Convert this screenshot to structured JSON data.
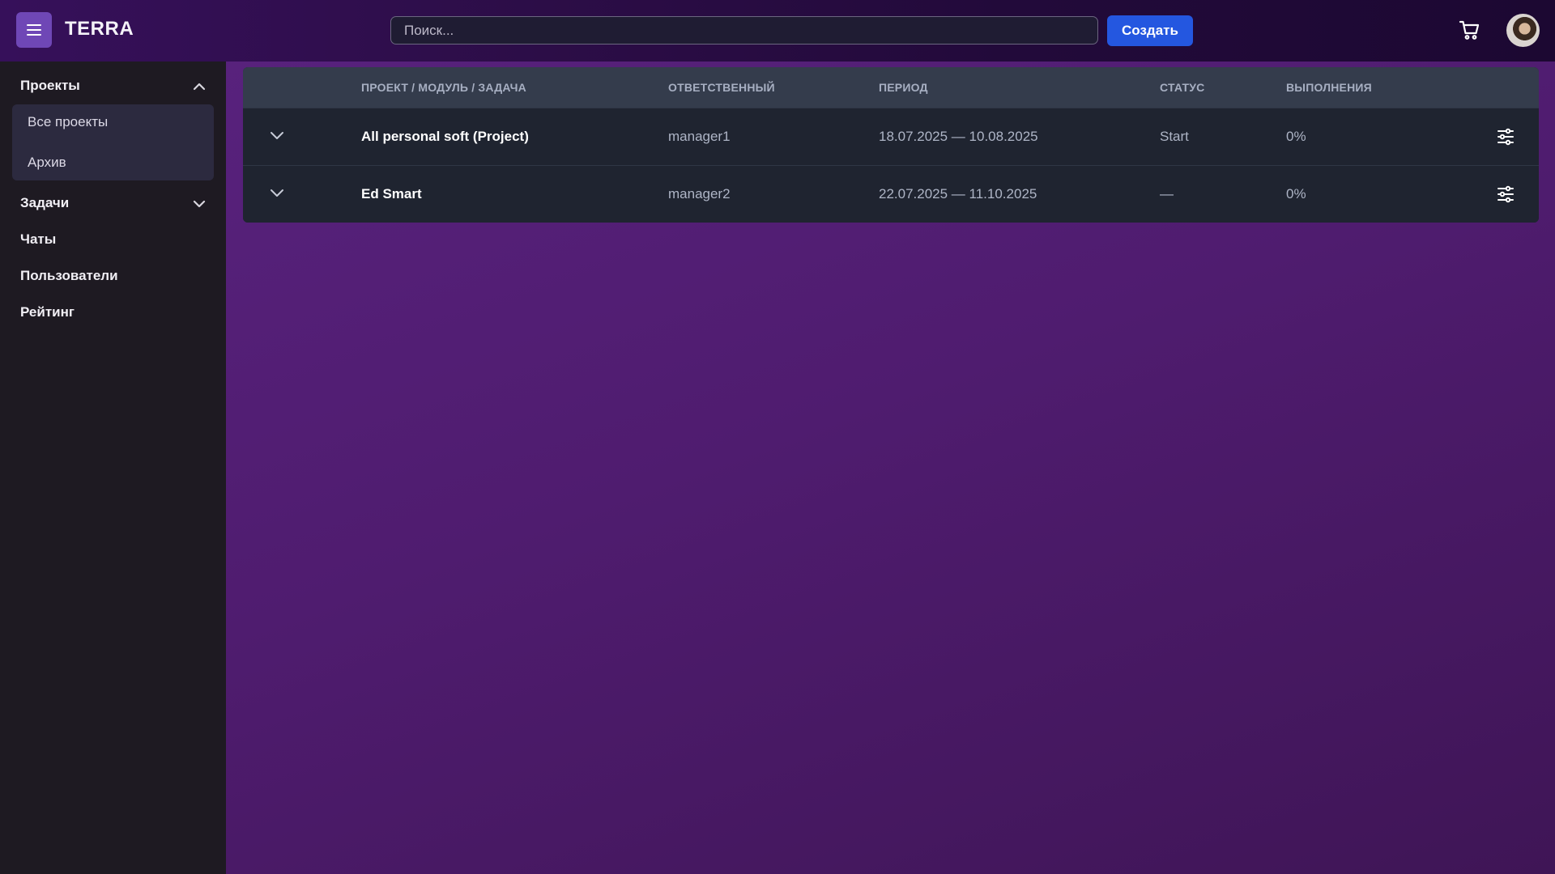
{
  "header": {
    "logo": "TERRA",
    "search_placeholder": "Поиск...",
    "create_label": "Создать"
  },
  "sidebar": {
    "sections": [
      {
        "label": "Проекты",
        "expanded": true,
        "items": [
          {
            "label": "Все проекты"
          },
          {
            "label": "Архив"
          }
        ]
      },
      {
        "label": "Задачи",
        "expanded": false
      },
      {
        "label": "Чаты"
      },
      {
        "label": "Пользователи"
      },
      {
        "label": "Рейтинг"
      }
    ]
  },
  "table": {
    "headers": {
      "project": "ПРОЕКТ / МОДУЛЬ / ЗАДАЧА",
      "responsible": "ОТВЕТСТВЕННЫЙ",
      "period": "ПЕРИОД",
      "status": "СТАТУС",
      "completion": "ВЫПОЛНЕНИЯ"
    },
    "rows": [
      {
        "name": "All personal soft (Project)",
        "responsible": "manager1",
        "period": "18.07.2025 — 10.08.2025",
        "status": "Start",
        "completion": "0%"
      },
      {
        "name": "Ed Smart",
        "responsible": "manager2",
        "period": "22.07.2025 — 11.10.2025",
        "status": "—",
        "completion": "0%"
      }
    ]
  },
  "colors": {
    "accent": "#2457e0",
    "menu_button": "#6f47b6",
    "sidebar_bg": "#1e1a22",
    "table_header_bg": "#343c4c",
    "table_row_bg": "#1f2430"
  },
  "icons": [
    "menu-icon",
    "cart-icon",
    "chevron-up-icon",
    "chevron-down-icon",
    "settings-sliders-icon"
  ]
}
